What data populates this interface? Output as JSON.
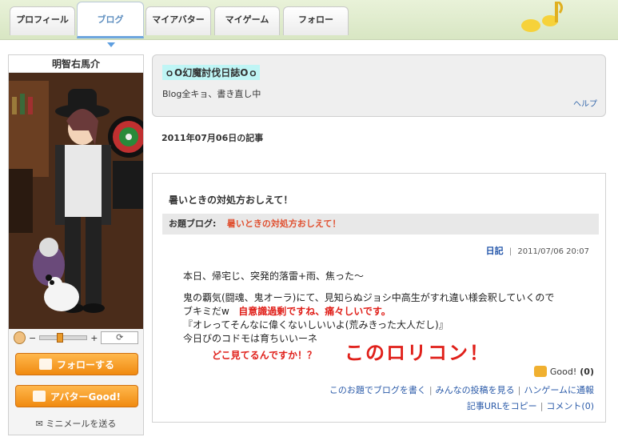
{
  "tabs": [
    {
      "label": "プロフィール"
    },
    {
      "label": "ブログ"
    },
    {
      "label": "マイアバター"
    },
    {
      "label": "マイゲーム"
    },
    {
      "label": "フォロー"
    }
  ],
  "profile": {
    "username": "明智右馬介",
    "zoom_minus": "−",
    "zoom_plus": "+",
    "zoom_level": 0.4,
    "refresh_label": "⟳",
    "follow_button": "フォローする",
    "good_button": "アバターGood!",
    "mail_link": "ミニメールを送る"
  },
  "blog": {
    "title": "ｏO幻魔討伐日誌Oｏ",
    "description": "Blog全キョ、書き直し中",
    "help": "ヘルプ"
  },
  "date_heading": "2011年07月06日の記事",
  "article": {
    "title": "暑いときの対処方おしえて！",
    "topic_key": "お題ブログ:",
    "topic_value": "暑いときの対処方おしえて！",
    "category": "日記",
    "timestamp": "2011/07/06 20:07",
    "line1": "本日、帰宅じ、突発的落雷+雨、焦った〜",
    "line2": "鬼の覇気(闘魂、鬼オーラ)にて、見知らぬジョシ中高生がすれ違い様会釈していくので",
    "line3a": "ブキミだw",
    "line3b": "自意識過剰ですね、痛々しいです。",
    "line4": "『オレってそんなに偉くないしいいよ(荒みきった大人だし)』",
    "line5": "今日びのコドモは育ちいいーネ",
    "red_sub": "どこ見てるんですか！？",
    "red_big": "このロリコン！",
    "good_label": "Good!",
    "good_count": "(0)",
    "link_write": "このお題でブログを書く",
    "link_all": "みんなの投稿を見る",
    "link_report": "ハンゲームに通報",
    "link_copy": "記事URLをコピー",
    "link_comment": "コメント(0)"
  },
  "colors": {
    "accent_blue": "#5f8fc0",
    "orange": "#f08a10",
    "red": "#e0201a"
  }
}
